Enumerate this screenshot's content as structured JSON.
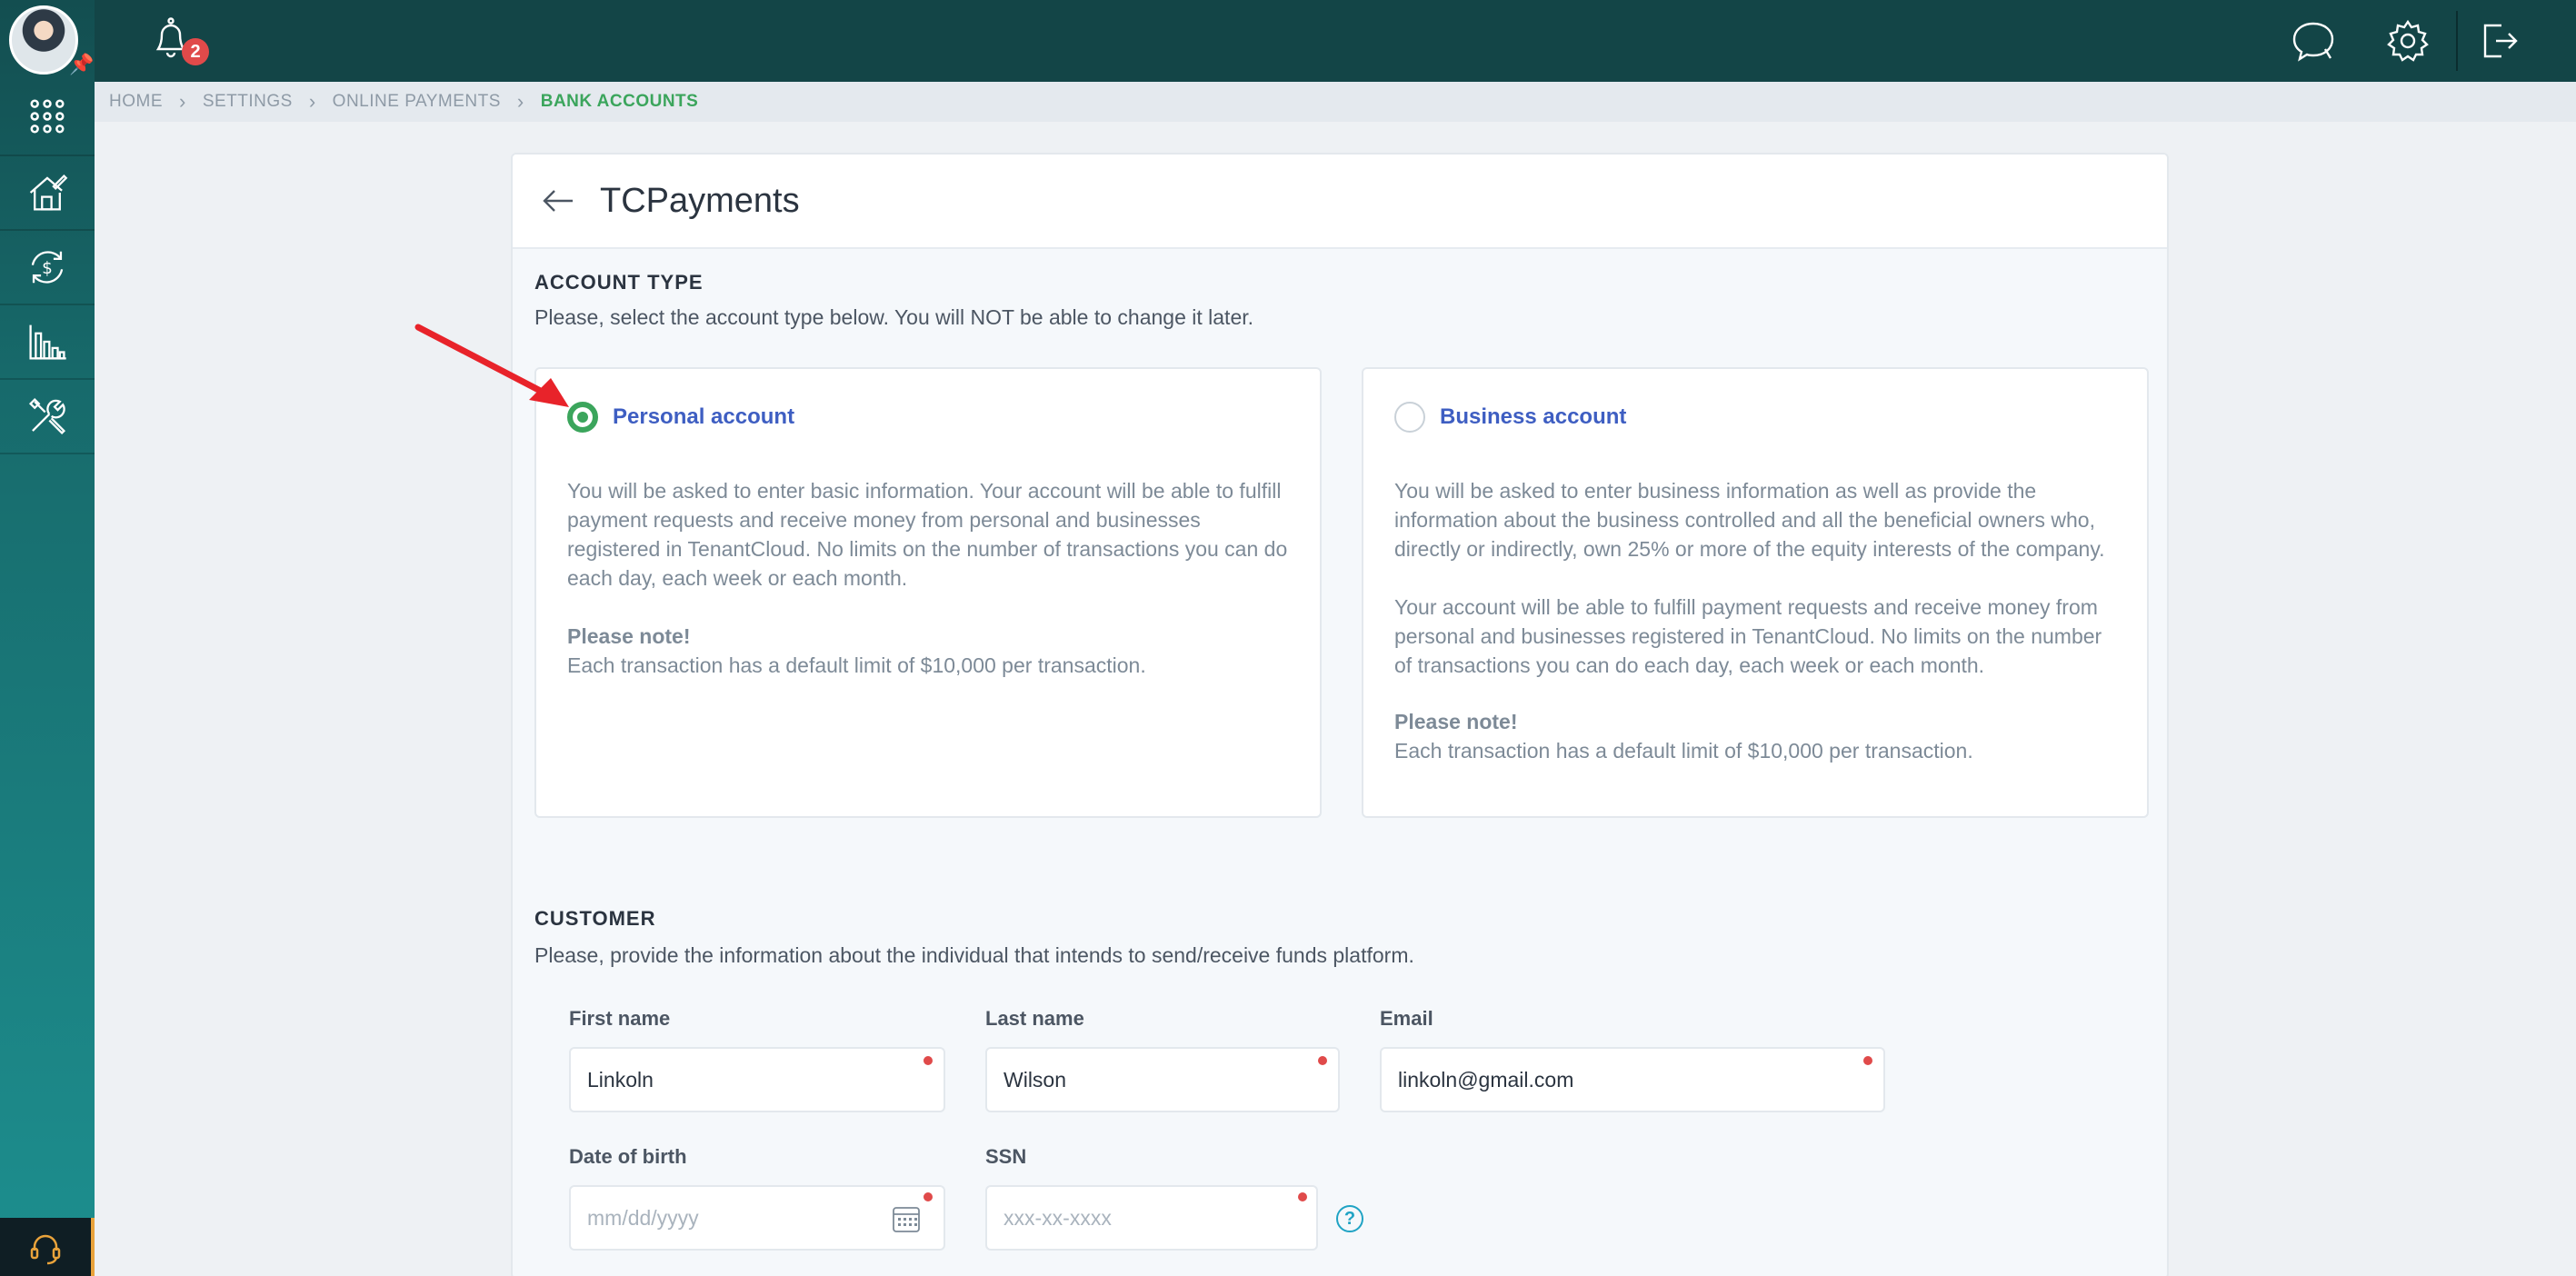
{
  "notifications": {
    "count": "2"
  },
  "breadcrumb": [
    {
      "label": "HOME"
    },
    {
      "label": "SETTINGS"
    },
    {
      "label": "ONLINE PAYMENTS"
    },
    {
      "label": "BANK ACCOUNTS"
    }
  ],
  "page": {
    "title": "TCPayments"
  },
  "account_type": {
    "title": "ACCOUNT TYPE",
    "description": "Please, select the account type below. You will NOT be able to change it later.",
    "personal": {
      "label": "Personal account",
      "selected": true,
      "text": "You will be asked to enter basic information. Your account will be able to fulfill payment requests and receive money from personal and businesses registered in TenantCloud. No limits on the number of transactions you can do each day, each week or each month.",
      "note_title": "Please note!",
      "note_text": "Each transaction has a default limit of $10,000 per transaction."
    },
    "business": {
      "label": "Business account",
      "selected": false,
      "text1": "You will be asked to enter business information as well as provide the information about the business controlled and all the beneficial owners who, directly or indirectly, own 25% or more of the equity interests of the company.",
      "text2": "Your account will be able to fulfill payment requests and receive money from personal and businesses registered in TenantCloud. No limits on the number of transactions you can do each day, each week or each month.",
      "note_title": "Please note!",
      "note_text": "Each transaction has a default limit of $10,000 per transaction."
    }
  },
  "customer": {
    "title": "CUSTOMER",
    "description": "Please, provide the information about the individual that intends to send/receive funds platform.",
    "first_name": {
      "label": "First name",
      "value": "Linkoln"
    },
    "last_name": {
      "label": "Last name",
      "value": "Wilson"
    },
    "email": {
      "label": "Email",
      "value": "linkoln@gmail.com"
    },
    "dob": {
      "label": "Date of birth",
      "placeholder": "mm/dd/yyyy"
    },
    "ssn": {
      "label": "SSN",
      "placeholder": "xxx-xx-xxxx",
      "help": "?"
    }
  },
  "colors": {
    "accent_green": "#3ba55c",
    "link_blue": "#3e5ec2",
    "sidebar": "#176a6b",
    "topbar": "#134547",
    "required_dot": "#e04a4a",
    "annotation_arrow": "#e8232a"
  },
  "icons": {
    "sidebar": [
      "apps-grid-icon",
      "home-edit-icon",
      "money-cycle-icon",
      "bar-chart-icon",
      "tools-icon"
    ],
    "topbar": [
      "bell-icon",
      "chat-icon",
      "gear-icon",
      "logout-icon"
    ]
  }
}
